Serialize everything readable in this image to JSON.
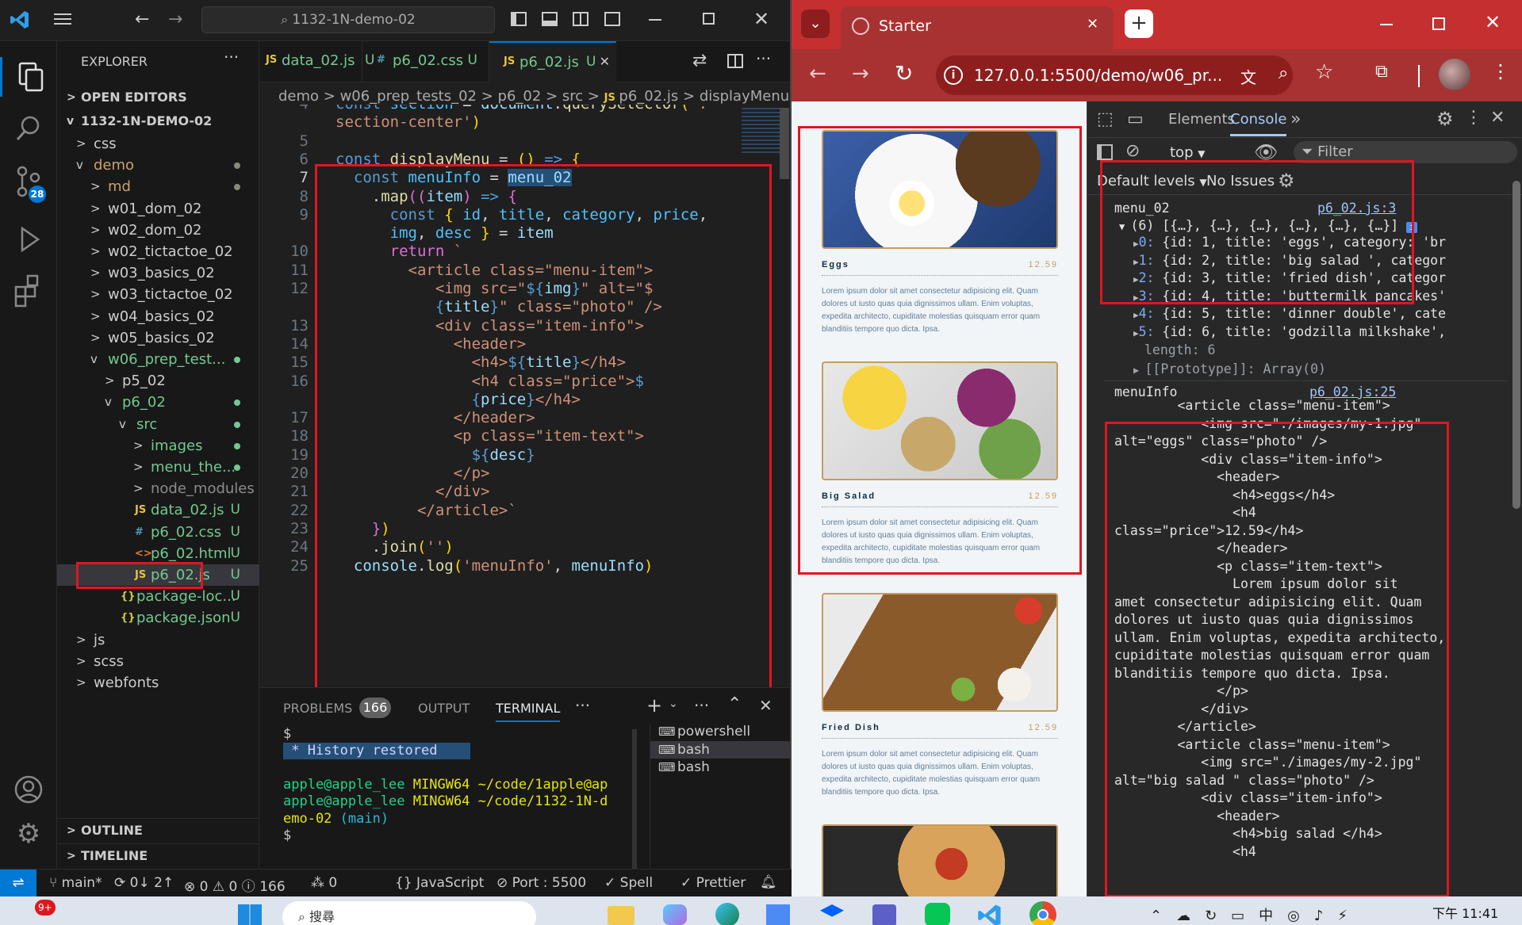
{
  "vscode": {
    "search_text": "1132-1N-demo-02",
    "explorer_title": "EXPLORER",
    "sections": {
      "open_editors": "OPEN EDITORS",
      "project": "1132-1N-DEMO-02",
      "outline": "OUTLINE",
      "timeline": "TIMELINE"
    },
    "badge_scm": "28",
    "tree": [
      {
        "label": "css",
        "indent": 1,
        "chev": ">",
        "type": "folder"
      },
      {
        "label": "demo",
        "indent": 1,
        "chev": "v",
        "type": "folder",
        "color": "olive",
        "dot": "#8a8a7a"
      },
      {
        "label": "md",
        "indent": 2,
        "chev": ">",
        "type": "folder",
        "color": "olive",
        "dot": "#8a8a7a"
      },
      {
        "label": "w01_dom_02",
        "indent": 2,
        "chev": ">",
        "type": "folder"
      },
      {
        "label": "w02_dom_02",
        "indent": 2,
        "chev": ">",
        "type": "folder"
      },
      {
        "label": "w02_tictactoe_02",
        "indent": 2,
        "chev": ">",
        "type": "folder"
      },
      {
        "label": "w03_basics_02",
        "indent": 2,
        "chev": ">",
        "type": "folder"
      },
      {
        "label": "w03_tictactoe_02",
        "indent": 2,
        "chev": ">",
        "type": "folder"
      },
      {
        "label": "w04_basics_02",
        "indent": 2,
        "chev": ">",
        "type": "folder"
      },
      {
        "label": "w05_basics_02",
        "indent": 2,
        "chev": ">",
        "type": "folder"
      },
      {
        "label": "w06_prep_test...",
        "indent": 2,
        "chev": "v",
        "type": "folder",
        "color": "green",
        "dot": "#73c991"
      },
      {
        "label": "p5_02",
        "indent": 3,
        "chev": ">",
        "type": "folder"
      },
      {
        "label": "p6_02",
        "indent": 3,
        "chev": "v",
        "type": "folder",
        "color": "green",
        "dot": "#73c991"
      },
      {
        "label": "src",
        "indent": 4,
        "chev": "v",
        "type": "folder",
        "color": "green",
        "dot": "#73c991"
      },
      {
        "label": "images",
        "indent": 5,
        "chev": ">",
        "type": "folder",
        "color": "green",
        "dot": "#73c991"
      },
      {
        "label": "menu_the...",
        "indent": 5,
        "chev": ">",
        "type": "folder",
        "color": "green",
        "dot": "#73c991"
      },
      {
        "label": "node_modules",
        "indent": 5,
        "chev": ">",
        "type": "folder",
        "color": "grey"
      },
      {
        "label": "data_02.js",
        "indent": 5,
        "icon": "JS",
        "type": "file",
        "color": "green",
        "status": "U"
      },
      {
        "label": "p6_02.css",
        "indent": 5,
        "icon": "#",
        "type": "file",
        "color": "green",
        "status": "U"
      },
      {
        "label": "p6_02.html",
        "indent": 5,
        "icon": "<>",
        "type": "file",
        "color": "green",
        "status": "U"
      },
      {
        "label": "p6_02.js",
        "indent": 5,
        "icon": "JS",
        "type": "file",
        "color": "green",
        "status": "U",
        "selected": true
      },
      {
        "label": "package-loc...",
        "indent": 4,
        "icon": "{}",
        "type": "file",
        "color": "green",
        "status": "U"
      },
      {
        "label": "package.json",
        "indent": 4,
        "icon": "{}",
        "type": "file",
        "color": "green",
        "status": "U"
      },
      {
        "label": "js",
        "indent": 1,
        "chev": ">",
        "type": "folder"
      },
      {
        "label": "scss",
        "indent": 1,
        "chev": ">",
        "type": "folder"
      },
      {
        "label": "webfonts",
        "indent": 1,
        "chev": ">",
        "type": "folder"
      }
    ],
    "tabs": [
      {
        "icon": "JS",
        "label": "data_02.js",
        "status": "U"
      },
      {
        "icon": "#",
        "label": "p6_02.css",
        "status": "U"
      },
      {
        "icon": "JS",
        "label": "p6_02.js",
        "status": "U",
        "active": true
      }
    ],
    "breadcrumb": [
      "demo",
      ">",
      "w06_prep_tests_02",
      ">",
      "p6_02",
      ">",
      "src",
      ">",
      "JS",
      "p6_02.js",
      ">",
      "displayMenu"
    ],
    "code": [
      {
        "n": "4",
        "html": "<span class='kw'>const</span> <span class='cl'>section</span> <span class='pl'>=</span> <span class='vr'>document</span><span class='pl'>.</span><span class='fn'>querySelector</span><span class='br'>(</span><span class='st2'>'.</span>"
      },
      {
        "n": "",
        "html": "<span class='st2'>section-center'</span><span class='br'>)</span>"
      },
      {
        "n": "5",
        "html": ""
      },
      {
        "n": "6",
        "html": "<span class='kw'>const</span> <span class='fn'>displayMenu</span> <span class='pl'>=</span> <span class='br'>()</span> <span class='kw'>=&gt;</span> <span class='br'>{</span>"
      },
      {
        "n": "7",
        "html": "  <span class='kw'>const</span> <span class='cl'>menuInfo</span> <span class='pl'>=</span> <span class='vr' style='background:#264f78'>menu_02</span>"
      },
      {
        "n": "8",
        "html": "    <span class='pl'>.</span><span class='fn'>map</span><span class='br2'>((</span><span class='vr'>item</span><span class='br2'>)</span> <span class='kw'>=&gt;</span> <span class='br2'>{</span>"
      },
      {
        "n": "9",
        "html": "      <span class='kw'>const</span> <span class='br'>{</span> <span class='cl'>id</span><span class='pl'>,</span> <span class='cl'>title</span><span class='pl'>,</span> <span class='cl'>category</span><span class='pl'>,</span> <span class='cl'>price</span><span class='pl'>,</span>"
      },
      {
        "n": "",
        "html": "      <span class='cl'>img</span><span class='pl'>,</span> <span class='cl'>desc</span> <span class='br'>}</span> <span class='pl'>=</span> <span class='vr'>item</span>"
      },
      {
        "n": "10",
        "html": "      <span class='br2'>return</span> <span class='st2'>`</span>"
      },
      {
        "n": "11",
        "html": "        <span class='st2'>&lt;article class=\"menu-item\"&gt;</span>"
      },
      {
        "n": "12",
        "html": "           <span class='st2'>&lt;img src=\"</span><span class='kw'>${</span><span class='vr'>img</span><span class='kw'>}</span><span class='st2'>\" alt=\"$</span>"
      },
      {
        "n": "",
        "html": "           <span class='kw'>{</span><span class='vr'>title</span><span class='kw'>}</span><span class='st2'>\" class=\"photo\" /&gt;</span>"
      },
      {
        "n": "13",
        "html": "           <span class='st2'>&lt;div class=\"item-info\"&gt;</span>"
      },
      {
        "n": "14",
        "html": "             <span class='st2'>&lt;header&gt;</span>"
      },
      {
        "n": "15",
        "html": "               <span class='st2'>&lt;h4&gt;</span><span class='kw'>${</span><span class='vr'>title</span><span class='kw'>}</span><span class='st2'>&lt;/h4&gt;</span>"
      },
      {
        "n": "16",
        "html": "               <span class='st2'>&lt;h4 class=\"price\"&gt;</span><span class='kw'>$</span>"
      },
      {
        "n": "",
        "html": "               <span class='kw'>{</span><span class='vr'>price</span><span class='kw'>}</span><span class='st2'>&lt;/h4&gt;</span>"
      },
      {
        "n": "17",
        "html": "             <span class='st2'>&lt;/header&gt;</span>"
      },
      {
        "n": "18",
        "html": "             <span class='st2'>&lt;p class=\"item-text\"&gt;</span>"
      },
      {
        "n": "19",
        "html": "               <span class='kw'>${</span><span class='vr'>desc</span><span class='kw'>}</span>"
      },
      {
        "n": "20",
        "html": "             <span class='st2'>&lt;/p&gt;</span>"
      },
      {
        "n": "21",
        "html": "           <span class='st2'>&lt;/div&gt;</span>"
      },
      {
        "n": "22",
        "html": "         <span class='st2'>&lt;/article&gt;`</span>"
      },
      {
        "n": "23",
        "html": "    <span class='br2'>}</span><span class='br'>)</span>"
      },
      {
        "n": "24",
        "html": "    <span class='pl'>.</span><span class='fn'>join</span><span class='br'>(</span><span class='st2'>''</span><span class='br'>)</span>"
      },
      {
        "n": "25",
        "html": "  <span class='vr'>console</span><span class='pl'>.</span><span class='fn'>log</span><span class='br'>(</span><span class='st2'>'menuInfo'</span><span class='pl'>,</span> <span class='vr'>menuInfo</span><span class='br'>)</span>"
      }
    ],
    "panel": {
      "tabs": [
        "PROBLEMS",
        "OUTPUT",
        "TERMINAL"
      ],
      "problems_count": "166",
      "terminal_lines": [
        "$",
        "* History restored",
        "",
        "apple@apple_lee MINGW64 ~/code/1apple@ap",
        "apple@apple_lee MINGW64 ~/code/1132-1N-d",
        "emo-02 (main)",
        "$"
      ],
      "terminals": [
        "powershell",
        "bash",
        "bash"
      ]
    },
    "status": {
      "branch": "main*",
      "sync": "0↓ 2↑",
      "errors": "0",
      "warnings": "0",
      "info": "166",
      "ports": "0",
      "language": "JavaScript",
      "port": "Port : 5500",
      "spell": "Spell",
      "prettier": "Prettier"
    }
  },
  "chrome": {
    "tab_title": "Starter",
    "url": "127.0.0.1:5500/demo/w06_pr...",
    "menu_items": [
      {
        "title": "Eggs",
        "price": "12.59",
        "text": "Lorem ipsum dolor sit amet consectetur adipisicing elit. Quam dolores ut iusto quas quia dignissimos ullam. Enim voluptas, expedita architecto, cupiditate molestias quisquam error quam blanditiis tempore quo dicta. Ipsa."
      },
      {
        "title": "Big Salad",
        "price": "12.59",
        "text": "Lorem ipsum dolor sit amet consectetur adipisicing elit. Quam dolores ut iusto quas quia dignissimos ullam. Enim voluptas, expedita architecto, cupiditate molestias quisquam error quam blanditiis tempore quo dicta. Ipsa."
      },
      {
        "title": "Fried Dish",
        "price": "12.59",
        "text": "Lorem ipsum dolor sit amet consectetur adipisicing elit. Quam dolores ut iusto quas quia dignissimos ullam. Enim voluptas, expedita architecto, cupiditate molestias quisquam error quam blanditiis tempore quo dicta. Ipsa."
      }
    ],
    "devtools": {
      "tabs": [
        "Elements",
        "Console"
      ],
      "context": "top",
      "filter_placeholder": "Filter",
      "levels": "Default levels",
      "issues": "No Issues",
      "log1_label": "menu_02",
      "log1_src": "p6_02.js:3",
      "array_summary": "(6) [{…}, {…}, {…}, {…}, {…}, {…}]",
      "array_items": [
        "0: {id: 1, title: 'eggs', category: 'br",
        "1: {id: 2, title: 'big salad ', categor",
        "2: {id: 3, title: 'fried dish', categor",
        "3: {id: 4, title: 'buttermilk pancakes'",
        "4: {id: 5, title: 'dinner double', cate",
        "5: {id: 6, title: 'godzilla milkshake',"
      ],
      "length_line": "length: 6",
      "prototype_line": "[[Prototype]]: Array(0)",
      "log2_label": "menuInfo",
      "log2_src": "p6_02.js:25",
      "output": "        <article class=\"menu-item\">\n           <img src=\"./images/my-1.jpg\"\nalt=\"eggs\" class=\"photo\" />\n           <div class=\"item-info\">\n             <header>\n               <h4>eggs</h4>\n               <h4\nclass=\"price\">12.59</h4>\n             </header>\n             <p class=\"item-text\">\n               Lorem ipsum dolor sit\namet consectetur adipisicing elit. Quam\ndolores ut iusto quas quia dignissimos\nullam. Enim voluptas, expedita architecto,\ncupiditate molestias quisquam error quam\nblanditiis tempore quo dicta. Ipsa.\n             </p>\n           </div>\n        </article>\n        <article class=\"menu-item\">\n           <img src=\"./images/my-2.jpg\"\nalt=\"big salad \" class=\"photo\" />\n           <div class=\"item-info\">\n             <header>\n               <h4>big salad </h4>\n               <h4"
    }
  },
  "taskbar": {
    "time": "下午 11:41",
    "notif_badge": "9+",
    "search_label": "搜尋"
  }
}
